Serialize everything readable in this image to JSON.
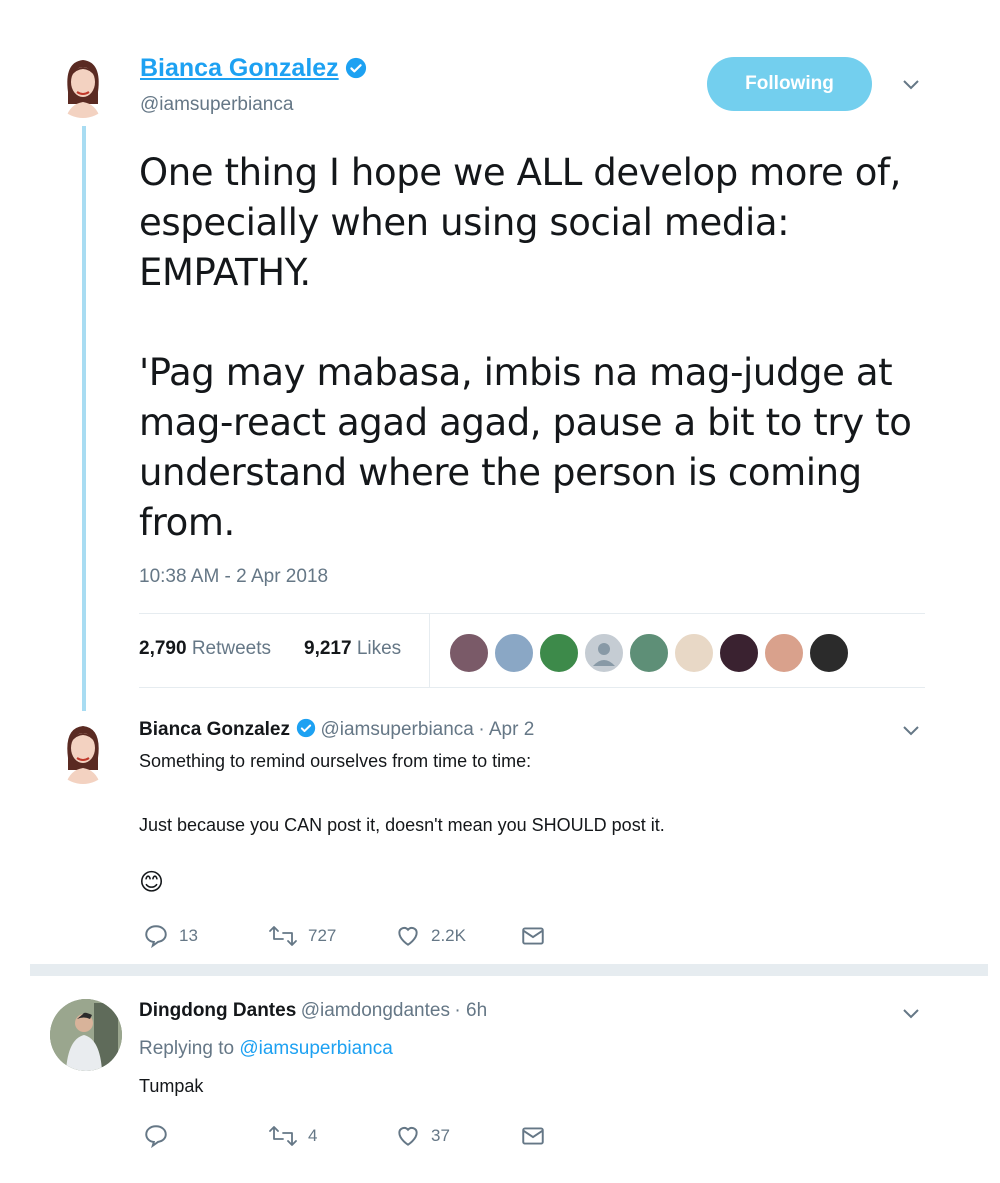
{
  "main_tweet": {
    "author_name": "Bianca Gonzalez",
    "author_handle": "@iamsuperbianca",
    "follow_button_label": "Following",
    "text": "One thing I hope we ALL develop more of, especially when using social media: EMPATHY.\n\n'Pag may mabasa, imbis na mag-judge at mag-react agad agad, pause a bit to try to understand where the person is coming from.",
    "timestamp": "10:38 AM - 2 Apr 2018",
    "retweets_count": "2,790",
    "retweets_label": "Retweets",
    "likes_count": "9,217",
    "likes_label": "Likes"
  },
  "quoted_reply": {
    "author_name": "Bianca Gonzalez",
    "author_handle": "@iamsuperbianca",
    "date": "· Apr 2",
    "line1": "Something to remind ourselves from time to time:",
    "line2": "Just because you CAN post it, doesn't mean you SHOULD post it.",
    "emoji": "😊",
    "replies": "13",
    "retweets": "727",
    "likes": "2.2K"
  },
  "reply": {
    "author_name": "Dingdong Dantes",
    "author_handle": "@iamdongdantes",
    "time": "· 6h",
    "replying_prefix": "Replying to",
    "replying_to": "@iamsuperbianca",
    "text": "Tumpak",
    "replies": "",
    "retweets": "4",
    "likes": "37"
  },
  "colors": {
    "accent": "#1da1f2",
    "follow_button": "#73cfee",
    "thread_line": "#a8dcf2",
    "muted": "#657786"
  },
  "icons": {
    "verified": "verified-badge-icon",
    "chevron": "chevron-down-icon",
    "reply": "reply-icon",
    "retweet": "retweet-icon",
    "like": "heart-icon",
    "dm": "envelope-icon"
  }
}
